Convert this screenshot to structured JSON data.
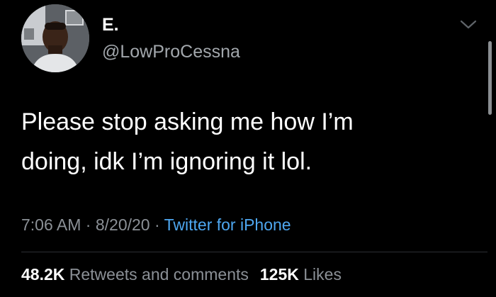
{
  "author": {
    "display_name": "E.",
    "handle": "@LowProCessna"
  },
  "tweet": {
    "line1": "Please stop asking me how I’m",
    "line2": "doing, idk I’m ignoring it lol."
  },
  "meta": {
    "time": "7:06 AM",
    "sep1": " · ",
    "date": "8/20/20",
    "sep2": " · ",
    "source": "Twitter for iPhone"
  },
  "stats": {
    "retweets_count": "48.2K",
    "retweets_label": "Retweets and comments",
    "likes_count": "125K",
    "likes_label": "Likes"
  },
  "colors": {
    "background": "#000000",
    "link": "#4ea7f0",
    "secondary_text": "#8b9096"
  },
  "icons": {
    "menu": "chevron-down-icon"
  }
}
